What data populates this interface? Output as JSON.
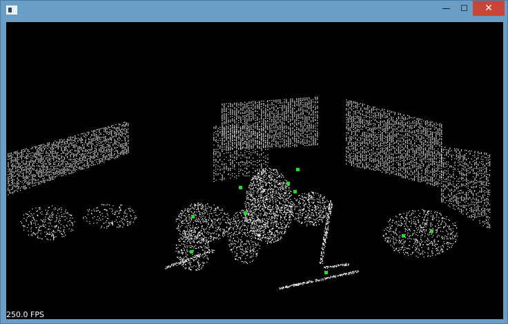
{
  "window": {
    "title": "",
    "controls": {
      "minimize": "—",
      "maximize": "☐",
      "close": "✕"
    }
  },
  "viewport": {
    "fps_text": "250.0 FPS",
    "background_color": "#000000",
    "point_color": "#ffffff",
    "marker_color": "#22dd22"
  }
}
